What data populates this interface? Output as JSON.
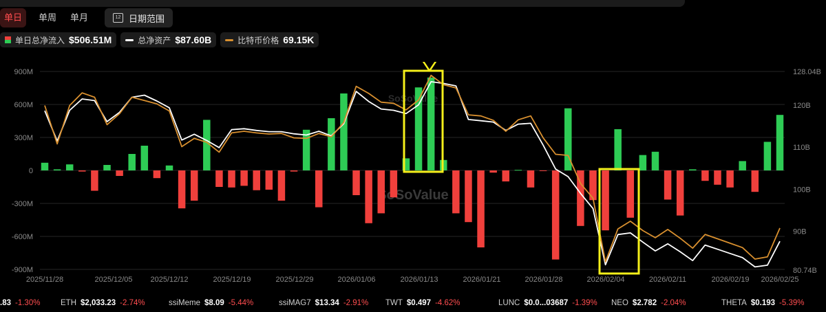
{
  "tabs": {
    "daily": "单日",
    "weekly": "单周",
    "monthly": "单月",
    "range": "日期范围",
    "calendar_day": "12"
  },
  "legend": {
    "netflow_label": "单日总净流入",
    "netflow_value": "$506.51M",
    "assets_label": "总净资产",
    "assets_value": "$87.60B",
    "btc_label": "比特币价格",
    "btc_value": "69.15K"
  },
  "watermark": "SoSoValue",
  "colors": {
    "positive": "#2ecc55",
    "negative": "#f0403c",
    "assets_line": "#ffffff",
    "btc_line": "#d9902f",
    "highlight": "#f5ef1a",
    "grid": "#262626",
    "axis_text": "#8a8a8a"
  },
  "chart_data": {
    "type": "bar",
    "x_tick_labels": [
      "2025/11/28",
      "2025/12/05",
      "2025/12/12",
      "2025/12/19",
      "2025/12/29",
      "2026/01/06",
      "2026/01/13",
      "2026/01/21",
      "2026/01/28",
      "2026/02/04",
      "2026/02/11",
      "2026/02/19",
      "2026/02/25"
    ],
    "y_left_ticks": [
      "900M",
      "600M",
      "300M",
      "0",
      "-300M",
      "-600M",
      "-900M"
    ],
    "y_left_range": [
      -900,
      900
    ],
    "y_right_ticks": [
      "128.04B",
      "120B",
      "110B",
      "100B",
      "90B",
      "80.74B"
    ],
    "y_right_range": [
      80.74,
      128.04
    ],
    "series": [
      {
        "name": "单日总净流入",
        "unit": "M USD",
        "type": "bar",
        "values": [
          70,
          10,
          55,
          -10,
          -185,
          50,
          -50,
          150,
          225,
          -70,
          45,
          -345,
          -275,
          460,
          -150,
          -155,
          -140,
          -180,
          -175,
          -275,
          -10,
          370,
          -335,
          475,
          700,
          -225,
          -480,
          -390,
          -245,
          110,
          755,
          845,
          95,
          -390,
          -470,
          -700,
          -20,
          -100,
          5,
          -155,
          -5,
          -810,
          565,
          -505,
          -270,
          -545,
          375,
          -430,
          140,
          170,
          -265,
          -410,
          10,
          -95,
          -130,
          -155,
          85,
          -195,
          260,
          505
        ]
      },
      {
        "name": "总净资产",
        "unit": "B USD",
        "type": "line",
        "values": [
          118.7,
          111.5,
          118.8,
          121.5,
          121.1,
          116.1,
          118.3,
          121.9,
          122.4,
          121.0,
          119.4,
          111.7,
          113.1,
          111.6,
          109.9,
          114.2,
          114.4,
          114.0,
          113.7,
          113.7,
          113.2,
          112.9,
          113.8,
          112.7,
          115.6,
          123.3,
          120.9,
          119.1,
          118.8,
          118.0,
          120.1,
          125.6,
          125.2,
          124.6,
          116.6,
          116.3,
          116.0,
          114.0,
          115.5,
          115.7,
          110.5,
          104.8,
          103.0,
          99.0,
          95.4,
          82.0,
          89.2,
          89.6,
          87.4,
          85.3,
          87.0,
          85.1,
          83.0,
          86.7,
          85.7,
          84.7,
          83.7,
          81.5,
          81.9,
          87.6
        ]
      },
      {
        "name": "比特币价格",
        "unit": "K USD",
        "type": "line",
        "values": [
          91.5,
          84.5,
          91.5,
          93.8,
          93.0,
          88.0,
          90.0,
          93.0,
          92.4,
          91.8,
          90.5,
          84.0,
          85.5,
          84.8,
          83.0,
          86.5,
          86.8,
          86.5,
          86.3,
          86.4,
          85.6,
          85.5,
          86.4,
          85.8,
          88.4,
          95.0,
          93.7,
          92.1,
          91.9,
          90.7,
          92.5,
          97.0,
          95.3,
          94.7,
          89.8,
          89.6,
          88.8,
          86.8,
          88.9,
          89.6,
          85.6,
          82.6,
          82.4,
          77.3,
          74.6,
          63.0,
          69.0,
          70.4,
          68.7,
          67.4,
          68.9,
          67.3,
          65.5,
          68.0,
          67.2,
          66.4,
          65.6,
          63.5,
          63.9,
          69.15
        ]
      }
    ],
    "annotations": [
      {
        "type": "highlight-box",
        "range": "2026/01/13 bars"
      },
      {
        "type": "arrow",
        "target": "2026/01/14 peak"
      },
      {
        "type": "highlight-box",
        "range": "2026/02/04–05"
      }
    ]
  },
  "ticker": [
    {
      "name": "",
      "price": ".83",
      "change": "-1.30%"
    },
    {
      "name": "ETH",
      "price": "$2,033.23",
      "change": "-2.74%"
    },
    {
      "name": "ssiMeme",
      "price": "$8.09",
      "change": "-5.44%"
    },
    {
      "name": "ssiMAG7",
      "price": "$13.34",
      "change": "-2.91%"
    },
    {
      "name": "TWT",
      "price": "$0.497",
      "change": "-4.62%"
    },
    {
      "name": "LUNC",
      "price": "$0.0...03687",
      "change": "-1.39%"
    },
    {
      "name": "NEO",
      "price": "$2.782",
      "change": "-2.04%"
    },
    {
      "name": "THETA",
      "price": "$0.193",
      "change": "-5.39%"
    }
  ]
}
